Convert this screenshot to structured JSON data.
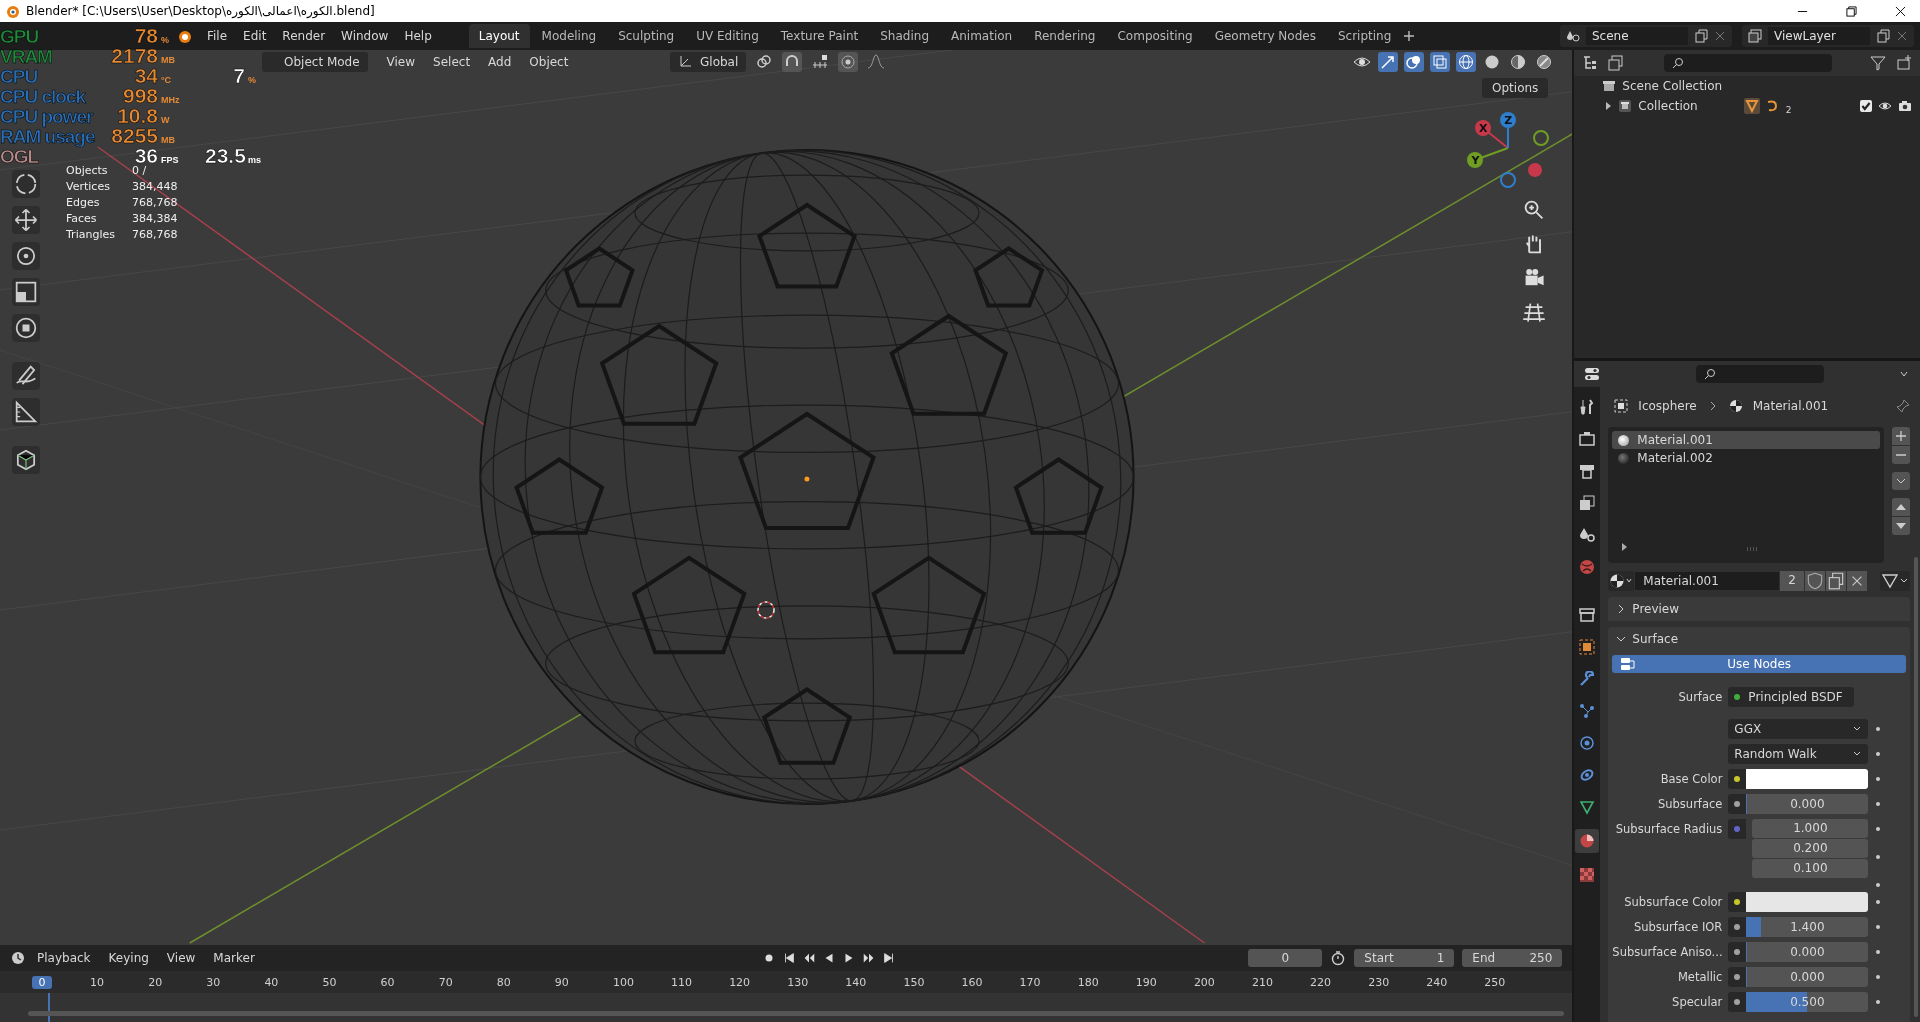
{
  "window": {
    "title": "Blender* [C:\\Users\\User\\Desktop\\الكوره\\اعمالى\\الكوره.blend]"
  },
  "menu": [
    "File",
    "Edit",
    "Render",
    "Window",
    "Help"
  ],
  "workspaces": [
    {
      "label": "Layout",
      "selected": true
    },
    {
      "label": "Modeling",
      "selected": false
    },
    {
      "label": "Sculpting",
      "selected": false
    },
    {
      "label": "UV Editing",
      "selected": false
    },
    {
      "label": "Texture Paint",
      "selected": false
    },
    {
      "label": "Shading",
      "selected": false
    },
    {
      "label": "Animation",
      "selected": false
    },
    {
      "label": "Rendering",
      "selected": false
    },
    {
      "label": "Compositing",
      "selected": false
    },
    {
      "label": "Geometry Nodes",
      "selected": false
    },
    {
      "label": "Scripting",
      "selected": false
    }
  ],
  "scene": {
    "name": "Scene"
  },
  "view_layer": {
    "name": "ViewLayer"
  },
  "viewport": {
    "mode": "Object Mode",
    "menus": [
      "View",
      "Select",
      "Add",
      "Object"
    ],
    "orientation": "Global",
    "options": "Options",
    "stats": [
      {
        "label": "Objects",
        "value": "0 /"
      },
      {
        "label": "Vertices",
        "value": "384,448"
      },
      {
        "label": "Edges",
        "value": "768,768"
      },
      {
        "label": "Faces",
        "value": "384,384"
      },
      {
        "label": "Triangles",
        "value": "768,768"
      }
    ],
    "gizmo_axes": [
      {
        "label": "X",
        "color": "#c8384b"
      },
      {
        "label": "Y",
        "color": "#6f9e23"
      },
      {
        "label": "Z",
        "color": "#2e7ecf"
      }
    ]
  },
  "overlay": [
    {
      "label": "GPU",
      "color": "#1f8a3c",
      "values": [
        {
          "value": "78",
          "unit": "%"
        }
      ]
    },
    {
      "label": "VRAM",
      "color": "#1f8a3c",
      "values": [
        {
          "value": "2178",
          "unit": "MB"
        }
      ]
    },
    {
      "label": "CPU",
      "color": "#2a6fb5",
      "values": [
        {
          "value": "34",
          "unit": "°C"
        },
        {
          "value": "7",
          "unit": "%"
        }
      ]
    },
    {
      "label": "CPU clock",
      "color": "#2a6fb5",
      "values": [
        {
          "value": "998",
          "unit": "MHz"
        }
      ]
    },
    {
      "label": "CPU power",
      "color": "#2a6fb5",
      "values": [
        {
          "value": "10.8",
          "unit": "W"
        }
      ]
    },
    {
      "label": "RAM usage",
      "color": "#2a6fb5",
      "values": [
        {
          "value": "8255",
          "unit": "MB"
        }
      ]
    },
    {
      "label": "OGL",
      "color": "#b48a8a",
      "values": [
        {
          "value": "36",
          "unit": "FPS"
        },
        {
          "value": "23.5",
          "unit": "ms"
        }
      ]
    }
  ],
  "outliner": {
    "items": [
      {
        "label": "Scene Collection",
        "children": [
          {
            "label": "Collection",
            "expanded": false,
            "count": "2",
            "checked": true
          }
        ]
      }
    ]
  },
  "properties": {
    "breadcrumb": [
      "Icosphere",
      "Material.001"
    ],
    "slots": [
      {
        "name": "Material.001",
        "selected": true
      },
      {
        "name": "Material.002",
        "selected": false
      }
    ],
    "material": {
      "name": "Material.001",
      "users": "2"
    },
    "panels": [
      {
        "label": "Preview",
        "expanded": false
      },
      {
        "label": "Surface",
        "expanded": true
      }
    ],
    "use_nodes": "Use Nodes",
    "rows": [
      {
        "kind": "shader",
        "label": "Surface",
        "value": "Principled BSDF"
      },
      {
        "kind": "dropdown",
        "value": "GGX"
      },
      {
        "kind": "dropdown",
        "value": "Random Walk"
      },
      {
        "kind": "color",
        "label": "Base Color",
        "color": "#ffffff"
      },
      {
        "kind": "number",
        "label": "Subsurface",
        "value": "0.000",
        "level": 0
      },
      {
        "kind": "vector",
        "label": "Subsurface Radius",
        "values": [
          "1.000",
          "0.200",
          "0.100"
        ]
      },
      {
        "kind": "color",
        "label": "Subsurface Color",
        "color": "#e6e6e6"
      },
      {
        "kind": "number",
        "label": "Subsurface IOR",
        "value": "1.400",
        "level": 0.12
      },
      {
        "kind": "number",
        "label": "Subsurface Aniso...",
        "value": "0.000",
        "level": 0
      },
      {
        "kind": "number",
        "label": "Metallic",
        "value": "0.000",
        "level": 0
      },
      {
        "kind": "number",
        "label": "Specular",
        "value": "0.500",
        "level": 0.5
      }
    ]
  },
  "timeline": {
    "menus": [
      "Playback",
      "Keying",
      "View",
      "Marker"
    ],
    "current_frame": "0",
    "start": {
      "label": "Start",
      "value": "1"
    },
    "end": {
      "label": "End",
      "value": "250"
    },
    "ruler": [
      {
        "label": "0",
        "selected": true
      },
      {
        "label": "10",
        "selected": false
      },
      {
        "label": "20",
        "selected": false
      },
      {
        "label": "30",
        "selected": false
      },
      {
        "label": "40",
        "selected": false
      },
      {
        "label": "50",
        "selected": false
      },
      {
        "label": "60",
        "selected": false
      },
      {
        "label": "70",
        "selected": false
      },
      {
        "label": "80",
        "selected": false
      },
      {
        "label": "90",
        "selected": false
      },
      {
        "label": "100",
        "selected": false
      },
      {
        "label": "110",
        "selected": false
      },
      {
        "label": "120",
        "selected": false
      },
      {
        "label": "130",
        "selected": false
      },
      {
        "label": "140",
        "selected": false
      },
      {
        "label": "150",
        "selected": false
      },
      {
        "label": "160",
        "selected": false
      },
      {
        "label": "170",
        "selected": false
      },
      {
        "label": "180",
        "selected": false
      },
      {
        "label": "190",
        "selected": false
      },
      {
        "label": "200",
        "selected": false
      },
      {
        "label": "210",
        "selected": false
      },
      {
        "label": "220",
        "selected": false
      },
      {
        "label": "230",
        "selected": false
      },
      {
        "label": "240",
        "selected": false
      },
      {
        "label": "250",
        "selected": false
      }
    ]
  }
}
